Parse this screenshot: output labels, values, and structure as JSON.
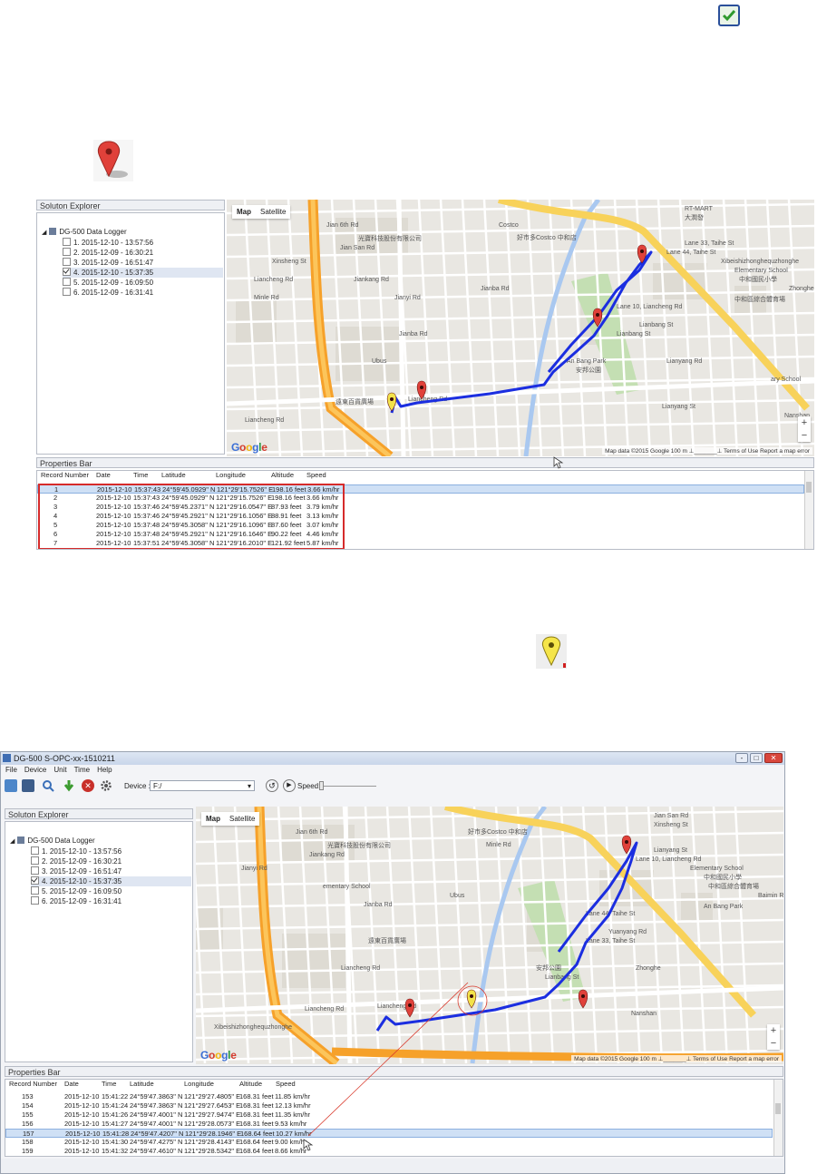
{
  "document": {
    "check_icon": "checkbox-check-icon",
    "pin_icon": "red-map-pin-icon",
    "yellow_pin_icon": "yellow-map-pin-icon"
  },
  "app": {
    "window_title": "DG-500 S-OPC-xx-1510211",
    "menu": [
      "File",
      "Device",
      "Unit",
      "Time",
      "Help"
    ],
    "device_label": "Device :",
    "device_value": "F:/",
    "speed_label": "Speed:",
    "win_buttons": [
      "-",
      "□",
      "✕"
    ]
  },
  "explorer": {
    "title": "Soluton Explorer",
    "root": "DG-500 Data Logger",
    "items": [
      {
        "label": "1. 2015-12-10 - 13:57:56",
        "checked": false
      },
      {
        "label": "2. 2015-12-09 - 16:30:21",
        "checked": false
      },
      {
        "label": "3. 2015-12-09 - 16:51:47",
        "checked": false
      },
      {
        "label": "4. 2015-12-10 - 15:37:35",
        "checked": true
      },
      {
        "label": "5. 2015-12-09 - 16:09:50",
        "checked": false
      },
      {
        "label": "6. 2015-12-09 - 16:31:41",
        "checked": false
      }
    ]
  },
  "map": {
    "tab_map": "Map",
    "tab_satellite": "Satellite",
    "footer": "Map data ©2015 Google   100 m ⊥_______⊥   Terms of Use   Report a map error",
    "logo": [
      "G",
      "o",
      "o",
      "g",
      "l",
      "e"
    ],
    "zoom_in": "+",
    "zoom_out": "−",
    "labels1": [
      "Jian 6th Rd",
      "光寶科技股份有限公司",
      "Costco",
      "好市多Costco 中和店",
      "RT-MART",
      "大潤發",
      "Xinsheng St",
      "Jian San Rd",
      "Jianyi Rd",
      "Jiankang Rd",
      "Jianba Rd",
      "Jianba Rd",
      "Ubus",
      "遠東百貨廣場",
      "Liancheng Rd",
      "Liancheng Rd",
      "Xibeishizhonghequzhonghe",
      "Elementary School",
      "中和國民小學",
      "中和區綜合體育場",
      "An Bang Park",
      "安邦公園",
      "Zhonghe",
      "Lane 44, Taihe St",
      "Lane 33, Taihe St",
      "Lane 10, Liancheng Rd",
      "Lianbang St",
      "Lianbang St",
      "Lianyang Rd",
      "Lianyang St",
      "Liancheng Rd",
      "Minle Rd",
      "ary School",
      "Nanshan"
    ],
    "labels2": [
      "Jian 6th Rd",
      "光寶科技股份有限公司",
      "好市多Costco 中和店",
      "Minle Rd",
      "Jian San Rd",
      "Xinsheng St",
      "Jianyi Rd",
      "Jiankang Rd",
      "Jianba Rd",
      "ementary School",
      "Ubus",
      "遠東百貨廣場",
      "Liancheng Rd",
      "Liancheng Rd",
      "Liancheng Rd",
      "Xibeishizhonghequzhonghe",
      "Elementary School",
      "中和國民小學",
      "中和區綜合體育場",
      "An Bang Park",
      "安邦公園",
      "Lianbang St",
      "Baimin Rd",
      "Lane 10, Liancheng Rd",
      "Lianyang St",
      "Lane 44, Taihe St",
      "Lane 33, Taihe St",
      "Yuanyang Rd",
      "Zhonghe",
      "Nanshan"
    ]
  },
  "properties": {
    "title": "Properties Bar",
    "headers": [
      "Record Number",
      "Date",
      "Time",
      "Latitude",
      "Longitude",
      "Altitude",
      "Speed"
    ],
    "rows1": [
      [
        "1",
        "2015-12-10",
        "15:37:43",
        "24°59'45.0929\" N",
        "121°29'15.7526\" E",
        "198.16 feet",
        "3.66 km/hr"
      ],
      [
        "2",
        "2015-12-10",
        "15:37:43",
        "24°59'45.0929\" N",
        "121°29'15.7526\" E",
        "198.16 feet",
        "3.66 km/hr"
      ],
      [
        "3",
        "2015-12-10",
        "15:37:46",
        "24°59'45.2371\" N",
        "121°29'16.0547\" E",
        "87.93 feet",
        "3.79 km/hr"
      ],
      [
        "4",
        "2015-12-10",
        "15:37:46",
        "24°59'45.2921\" N",
        "121°29'16.1056\" E",
        "88.91 feet",
        "3.13 km/hr"
      ],
      [
        "5",
        "2015-12-10",
        "15:37:48",
        "24°59'45.3058\" N",
        "121°29'16.1096\" E",
        "87.60 feet",
        "3.07 km/hr"
      ],
      [
        "6",
        "2015-12-10",
        "15:37:48",
        "24°59'45.2921\" N",
        "121°29'16.1646\" E",
        "90.22 feet",
        "4.46 km/hr"
      ],
      [
        "7",
        "2015-12-10",
        "15:37:51",
        "24°59'45.3058\" N",
        "121°29'16.2010\" E",
        "121.92 feet",
        "5.87 km/hr"
      ]
    ],
    "rows2": [
      [
        "153",
        "2015-12-10",
        "15:41:22",
        "24°59'47.3863\" N",
        "121°29'27.4805\" E",
        "168.31 feet",
        "11.85 km/hr"
      ],
      [
        "154",
        "2015-12-10",
        "15:41:24",
        "24°59'47.3863\" N",
        "121°29'27.6453\" E",
        "168.31 feet",
        "12.13 km/hr"
      ],
      [
        "155",
        "2015-12-10",
        "15:41:26",
        "24°59'47.4001\" N",
        "121°29'27.9474\" E",
        "168.31 feet",
        "11.35 km/hr"
      ],
      [
        "156",
        "2015-12-10",
        "15:41:27",
        "24°59'47.4001\" N",
        "121°29'28.0573\" E",
        "168.31 feet",
        "9.53 km/hr"
      ],
      [
        "157",
        "2015-12-10",
        "15:41:28",
        "24°59'47.4207\" N",
        "121°29'28.1946\" E",
        "168.64 feet",
        "10.27 km/hr"
      ],
      [
        "158",
        "2015-12-10",
        "15:41:30",
        "24°59'47.4275\" N",
        "121°29'28.4143\" E",
        "168.64 feet",
        "9.00 km/hr"
      ],
      [
        "159",
        "2015-12-10",
        "15:41:32",
        "24°59'47.4610\" N",
        "121°29'28.5342\" E",
        "168.64 feet",
        "8.66 km/hr"
      ]
    ],
    "selected_row2": "157"
  }
}
